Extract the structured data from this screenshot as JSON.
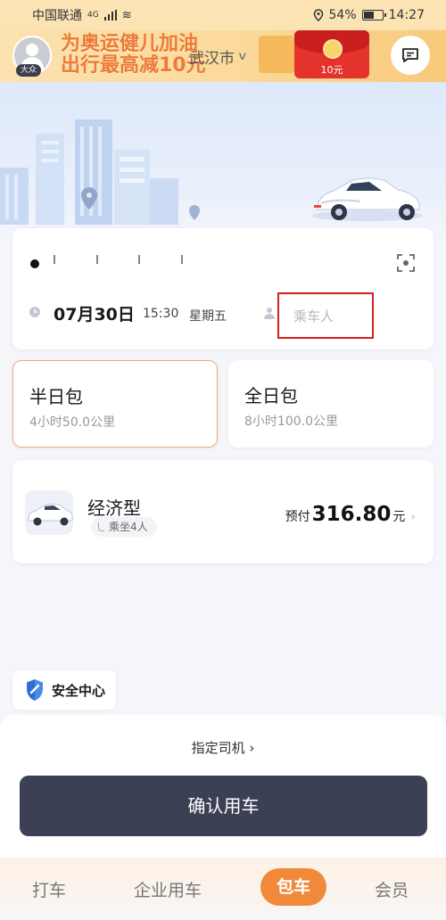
{
  "status_bar": {
    "carrier": "中国联通",
    "network": "4G",
    "battery": "54%",
    "time": "14:27"
  },
  "banner": {
    "avatar_badge": "大众",
    "promo_line1": "为奥运健儿加油",
    "promo_line2": "出行最高减10元",
    "city": "武汉市",
    "redpacket_amount": "10元"
  },
  "trip": {
    "pickup_address": "",
    "date": "07月30日",
    "time": "15:30",
    "weekday": "星期五",
    "passenger_placeholder": "乘车人"
  },
  "packages": [
    {
      "title": "半日包",
      "detail": "4小时50.0公里",
      "selected": true
    },
    {
      "title": "全日包",
      "detail": "8小时100.0公里",
      "selected": false
    }
  ],
  "car": {
    "type": "经济型",
    "seats": "乘坐4人",
    "price_prefix": "预付",
    "price": "316.80",
    "price_unit": "元"
  },
  "safety": {
    "label": "安全中心"
  },
  "sheet": {
    "assign_driver": "指定司机 ›",
    "confirm": "确认用车"
  },
  "tabs": [
    {
      "label": "打车",
      "active": false
    },
    {
      "label": "企业用车",
      "active": false
    },
    {
      "label": "包车",
      "active": true
    },
    {
      "label": "会员",
      "active": false
    }
  ],
  "colors": {
    "accent": "#f08a3a",
    "button": "#3c4054",
    "highlight_border": "#d21f1f"
  }
}
